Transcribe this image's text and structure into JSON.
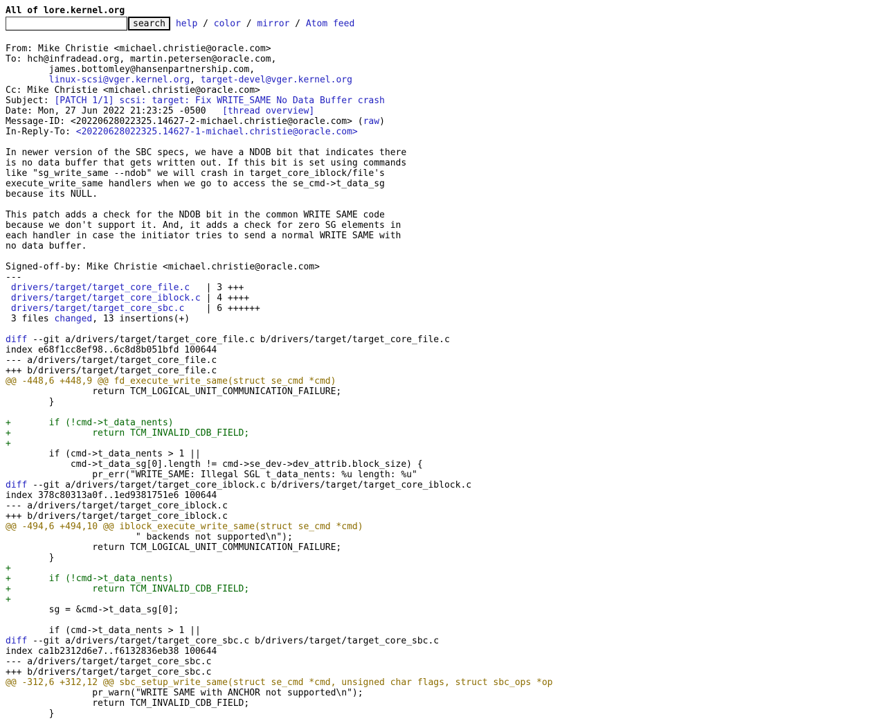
{
  "header": {
    "title": "All of lore.kernel.org",
    "search_button": "search",
    "nav": [
      {
        "label": "help"
      },
      {
        "label": "color"
      },
      {
        "label": "mirror"
      },
      {
        "label": "Atom feed"
      }
    ],
    "nav_sep": " / "
  },
  "message": {
    "from_label": "From: ",
    "from": "Mike Christie <michael.christie@oracle.com>",
    "to_label": "To: ",
    "to_line1": "hch@infradead.org, martin.petersen@oracle.com,",
    "to_line2": "james.bottomley@hansenpartnership.com,",
    "to_link1": "linux-scsi@vger.kernel.org",
    "to_sep": ", ",
    "to_link2": "target-devel@vger.kernel.org",
    "cc_label": "Cc: ",
    "cc": "Mike Christie <michael.christie@oracle.com>",
    "subject_label": "Subject: ",
    "subject": "[PATCH 1/1] scsi: target: Fix WRITE_SAME No Data Buffer crash",
    "date_label": "Date: ",
    "date": "Mon, 27 Jun 2022 21:23:25 -0500",
    "thread_overview": "[thread overview]",
    "msgid_label": "Message-ID: ",
    "msgid": "<20220628022325.14627-2-michael.christie@oracle.com>",
    "raw_open": " (",
    "raw": "raw",
    "raw_close": ")",
    "inreply_label": "In-Reply-To: ",
    "inreply_lt": "<",
    "inreply": "20220628022325.14627-1-michael.christie@oracle.com",
    "inreply_gt": ">"
  },
  "body": {
    "para1": [
      "In newer version of the SBC specs, we have a NDOB bit that indicates there",
      "is no data buffer that gets written out. If this bit is set using commands",
      "like \"sg_write_same --ndob\" we will crash in target_core_iblock/file's",
      "execute_write_same handlers when we go to access the se_cmd->t_data_sg",
      "because its NULL."
    ],
    "para2": [
      "This patch adds a check for the NDOB bit in the common WRITE SAME code",
      "because we don't support it. And, it adds a check for zero SG elements in",
      "each handler in case the initiator tries to send a normal WRITE SAME with",
      "no data buffer."
    ],
    "signoff": "Signed-off-by: Mike Christie <michael.christie@oracle.com>",
    "separator": "---"
  },
  "diffstat": {
    "files": [
      {
        "name": "drivers/target/target_core_file.c",
        "stat": "   | 3 +++"
      },
      {
        "name": "drivers/target/target_core_iblock.c",
        "stat": " | 4 ++++"
      },
      {
        "name": "drivers/target/target_core_sbc.c",
        "stat": "    | 6 ++++++"
      }
    ],
    "summary_pre": " 3 files ",
    "summary_link": "changed",
    "summary_post": ", 13 insertions(+)"
  },
  "diffs": [
    {
      "diff_link": "diff",
      "diff_rest": " --git a/drivers/target/target_core_file.c b/drivers/target/target_core_file.c",
      "index": "index e68f1cc8ef98..6c8d8b051bfd 100644",
      "minus": "--- a/drivers/target/target_core_file.c",
      "plus": "+++ b/drivers/target/target_core_file.c",
      "lines": [
        {
          "t": "hunk",
          "s": "@@ -448,6 +448,9 @@ fd_execute_write_same(struct se_cmd *cmd)"
        },
        {
          "t": "ctx",
          "s": " \t\treturn TCM_LOGICAL_UNIT_COMMUNICATION_FAILURE;"
        },
        {
          "t": "ctx",
          "s": " \t}"
        },
        {
          "t": "ctx",
          "s": " "
        },
        {
          "t": "add",
          "s": "+\tif (!cmd->t_data_nents)"
        },
        {
          "t": "add",
          "s": "+\t\treturn TCM_INVALID_CDB_FIELD;"
        },
        {
          "t": "add",
          "s": "+"
        },
        {
          "t": "ctx",
          "s": " \tif (cmd->t_data_nents > 1 ||"
        },
        {
          "t": "ctx",
          "s": " \t    cmd->t_data_sg[0].length != cmd->se_dev->dev_attrib.block_size) {"
        },
        {
          "t": "ctx",
          "s": " \t\tpr_err(\"WRITE_SAME: Illegal SGL t_data_nents: %u length: %u\""
        }
      ]
    },
    {
      "diff_link": "diff",
      "diff_rest": " --git a/drivers/target/target_core_iblock.c b/drivers/target/target_core_iblock.c",
      "index": "index 378c80313a0f..1ed9381751e6 100644",
      "minus": "--- a/drivers/target/target_core_iblock.c",
      "plus": "+++ b/drivers/target/target_core_iblock.c",
      "lines": [
        {
          "t": "hunk",
          "s": "@@ -494,6 +494,10 @@ iblock_execute_write_same(struct se_cmd *cmd)"
        },
        {
          "t": "ctx",
          "s": " \t\t\t\" backends not supported\\n\");"
        },
        {
          "t": "ctx",
          "s": " \t\treturn TCM_LOGICAL_UNIT_COMMUNICATION_FAILURE;"
        },
        {
          "t": "ctx",
          "s": " \t}"
        },
        {
          "t": "add",
          "s": "+"
        },
        {
          "t": "add",
          "s": "+\tif (!cmd->t_data_nents)"
        },
        {
          "t": "add",
          "s": "+\t\treturn TCM_INVALID_CDB_FIELD;"
        },
        {
          "t": "add",
          "s": "+"
        },
        {
          "t": "ctx",
          "s": " \tsg = &cmd->t_data_sg[0];"
        },
        {
          "t": "ctx",
          "s": " "
        },
        {
          "t": "ctx",
          "s": " \tif (cmd->t_data_nents > 1 ||"
        }
      ]
    },
    {
      "diff_link": "diff",
      "diff_rest": " --git a/drivers/target/target_core_sbc.c b/drivers/target/target_core_sbc.c",
      "index": "index ca1b2312d6e7..f6132836eb38 100644",
      "minus": "--- a/drivers/target/target_core_sbc.c",
      "plus": "+++ b/drivers/target/target_core_sbc.c",
      "lines": [
        {
          "t": "hunk",
          "s": "@@ -312,6 +312,12 @@ sbc_setup_write_same(struct se_cmd *cmd, unsigned char flags, struct sbc_ops *op"
        },
        {
          "t": "ctx",
          "s": " \t\tpr_warn(\"WRITE SAME with ANCHOR not supported\\n\");"
        },
        {
          "t": "ctx",
          "s": " \t\treturn TCM_INVALID_CDB_FIELD;"
        },
        {
          "t": "ctx",
          "s": " \t}"
        }
      ]
    }
  ]
}
